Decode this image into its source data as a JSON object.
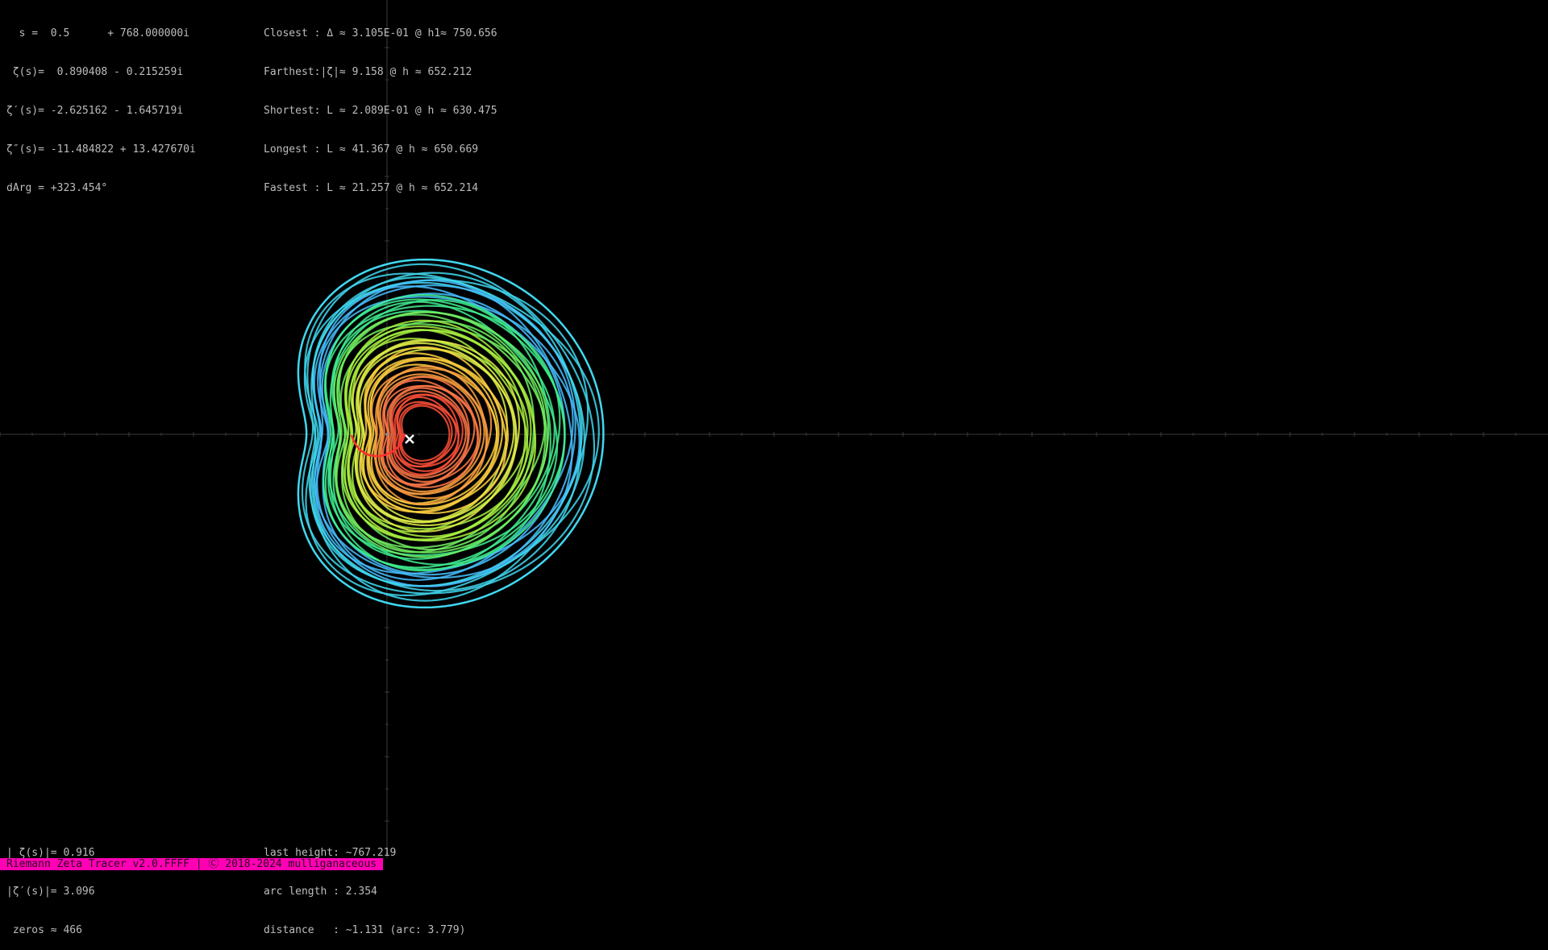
{
  "app": {
    "title": "Riemann Zeta Tracer v2.0.FFFF",
    "status_bar_text": "Riemann Zeta Tracer v2.0.FFFF | Ⓒ 2018-2024 mulliganaceous",
    "colors": {
      "background": "#000000",
      "text": "#bdbdbd",
      "axis": "#3a3a3a",
      "status_bar": "#ff00b4",
      "outer_curve": "#40d8f0",
      "marker": "#ffffff"
    }
  },
  "info_left": {
    "line1": "  s =  0.5      + 768.000000i",
    "line2": " ζ(s)=  0.890408 - 0.215259i",
    "line3": "ζ′(s)= -2.625162 - 1.645719i",
    "line4": "ζ″(s)= -11.484822 + 13.427670i",
    "line5": "dArg = +323.454°"
  },
  "info_mid": {
    "closest": "Closest : Δ ≈ 3.105E-01 @ h1≈ 750.656",
    "farthest": "Farthest:|ζ|≈ 9.158 @ h ≈ 652.212",
    "shortest": "Shortest: L ≈ 2.089E-01 @ h ≈ 630.475",
    "longest": "Longest : L ≈ 41.367 @ h ≈ 650.669",
    "fastest": "Fastest : L ≈ 21.257 @ h ≈ 652.214"
  },
  "stats_left": {
    "abs_zeta": "| ζ(s)|= 0.916",
    "abs_dzeta": "|ζ′(s)|= 3.096",
    "zeros": " zeros ≈ 466"
  },
  "stats_mid": {
    "last_height": "last height: ~767.219",
    "arc_length": "arc length : 2.354",
    "distance": "distance   : ~1.131 (arc: 3.779)"
  },
  "plot": {
    "icons": {
      "current_value_marker": "x-mark-icon",
      "origin": "origin-crosshair"
    },
    "spiral_colors": [
      "#40d8f0",
      "#46c0ff",
      "#40f090",
      "#70f060",
      "#a8f040",
      "#e0f048",
      "#ffd040",
      "#ffa040",
      "#ff7848",
      "#ff5038"
    ]
  }
}
